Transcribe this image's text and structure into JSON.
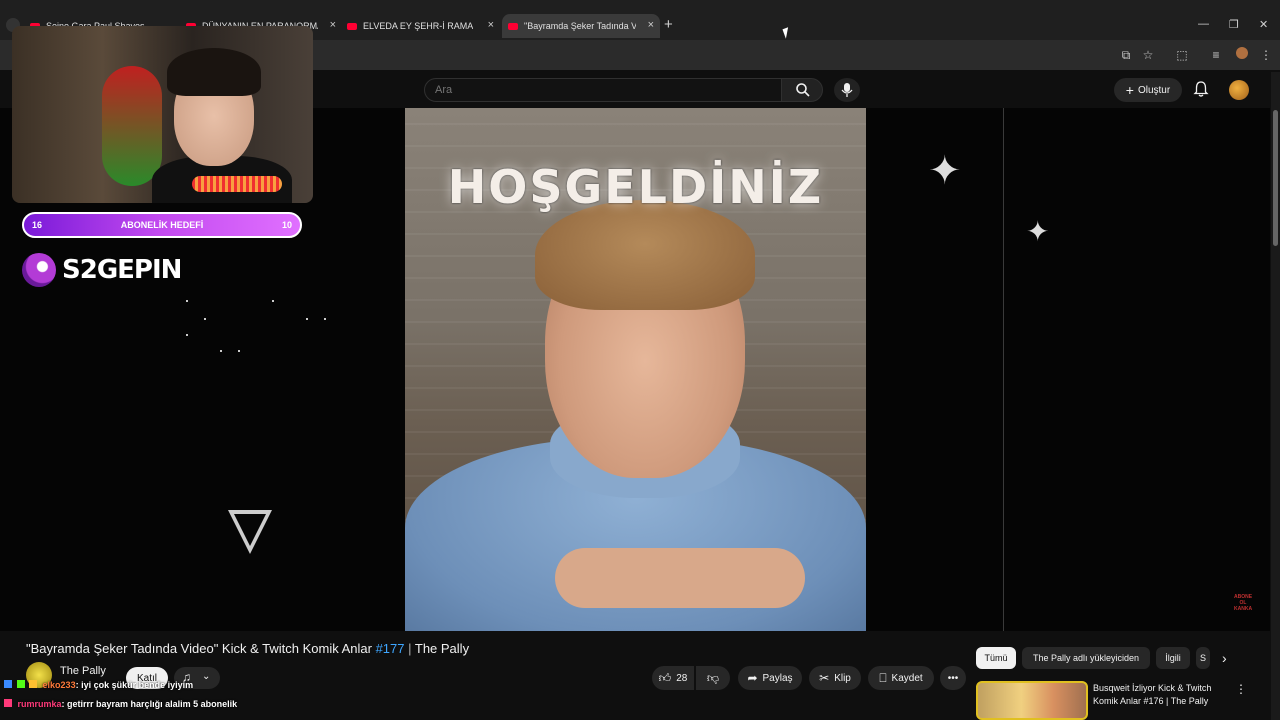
{
  "browser": {
    "tabs": [
      {
        "label": "Seine Gara Paul Shaves..."
      },
      {
        "label": "DÜNYANIN EN PARANORMAL"
      },
      {
        "label": "ELVEDA EY ŞEHR-İ RAMAZAN |"
      },
      {
        "label": "\"Bayramda Şeker Tadında Video"
      }
    ],
    "new_tab": "+",
    "close_glyph": "×",
    "controls": {
      "minimize": "—",
      "restore": "❐",
      "close": "✕"
    }
  },
  "youtube_header": {
    "search_placeholder": "Ara",
    "create_label": "Oluştur"
  },
  "stream_overlay": {
    "goal_left": "16",
    "goal_label": "ABONELİK HEDEFİ",
    "goal_right": "10",
    "brand": "S2GEPIN"
  },
  "video": {
    "overlay_text": "HOŞGELDİNİZ",
    "corner_badge": [
      "ABONE",
      "OL",
      "KANKA"
    ]
  },
  "video_info": {
    "title_main": "\"Bayramda Şeker Tadında Video\" Kick & Twitch Komik Anlar ",
    "title_tag": "#177",
    "title_sep": " | ",
    "title_channel": "The Pally",
    "channel_name": "The Pally",
    "channel_avatar_text": "The Pally",
    "join_label": "Katıl",
    "likes": "28",
    "share_label": "Paylaş",
    "clip_label": "Klip",
    "save_label": "Kaydet"
  },
  "recommendations": {
    "chips": [
      {
        "label": "Tümü",
        "selected": true
      },
      {
        "label": "The Pally adlı yükleyiciden",
        "selected": false
      },
      {
        "label": "İlgili",
        "selected": false
      },
      {
        "label": "S",
        "selected": false
      }
    ],
    "items": [
      {
        "title": "Busqweit İzliyor Kick & Twitch Komik Anlar #176 | The Pally"
      }
    ]
  },
  "chat": [
    {
      "user": "elko233",
      "message": ": iyi çok şükür bende iyiyim"
    },
    {
      "user": "rumrumka",
      "message": ": getirrr bayram harçlığı alalim 5 abonelik"
    }
  ],
  "colors": {
    "accent": "#3ea6ff",
    "brand_purple": "#b33bd6",
    "yt_red": "#ff0033"
  }
}
